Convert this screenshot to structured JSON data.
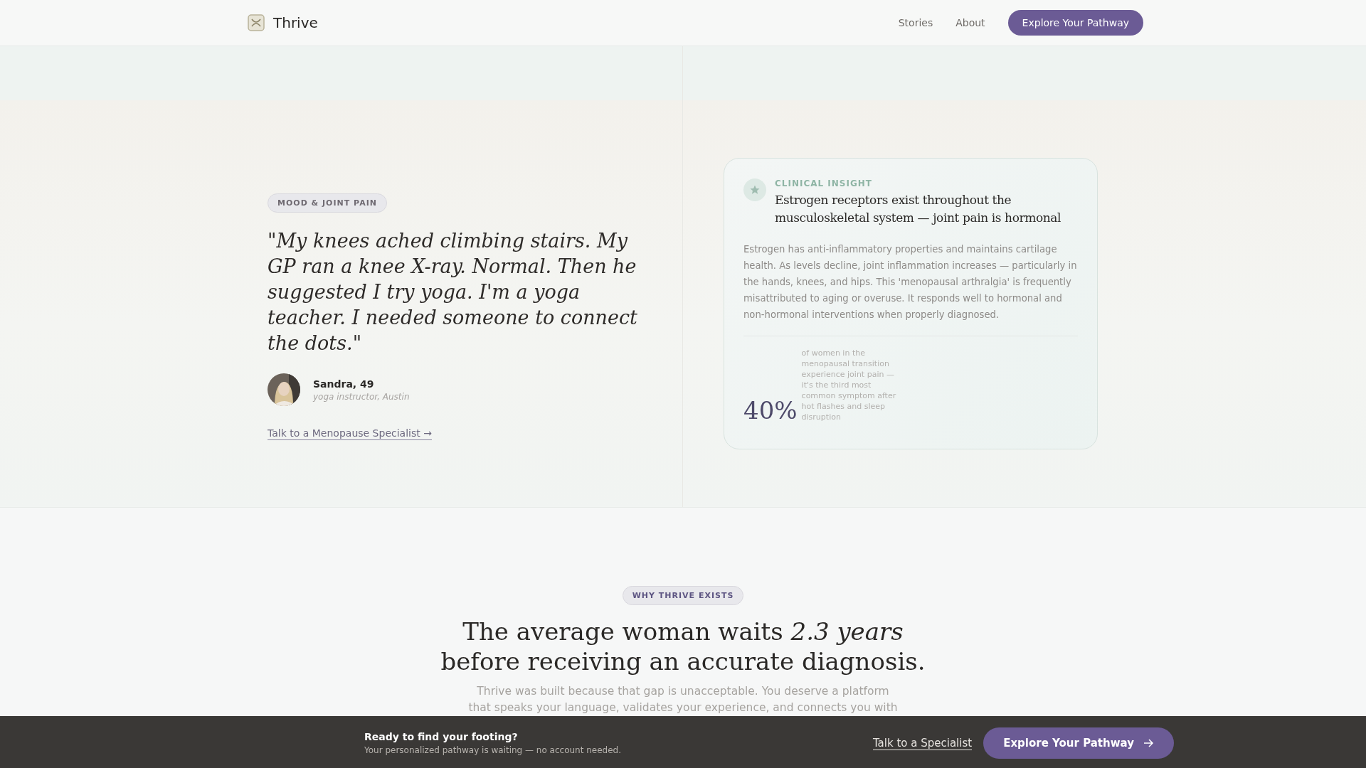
{
  "header": {
    "brand": "Thrive",
    "nav": [
      {
        "label": "Stories"
      },
      {
        "label": "About"
      }
    ],
    "cta": "Explore Your Pathway"
  },
  "story": {
    "tag": "MOOD & JOINT PAIN",
    "quote": "\"My knees ached climbing stairs. My GP ran a knee X-ray. Normal. Then he suggested I try yoga. I'm a yoga teacher. I needed someone to connect the dots.\"",
    "author": {
      "name": "Sandra, 49",
      "role": "yoga instructor, Austin"
    },
    "link": "Talk to a Menopause Specialist →"
  },
  "insight": {
    "eyebrow": "CLINICAL INSIGHT",
    "title": "Estrogen receptors exist throughout the musculoskeletal system — joint pain is hormonal",
    "body": "Estrogen has anti-inflammatory properties and maintains cartilage health. As levels decline, joint inflammation increases — particularly in the hands, knees, and hips. This 'menopausal arthralgia' is frequently misattributed to aging or overuse. It responds well to hormonal and non-hormonal interventions when properly diagnosed.",
    "stat": "40%",
    "stat_caption": "of women in the menopausal transition experience joint pain — it's the third most common symptom after hot flashes and sleep disruption"
  },
  "why": {
    "tag": "WHY THRIVE EXISTS",
    "heading_1": "The average woman waits *2.3 years*",
    "heading_2": "before receiving an accurate diagnosis.",
    "paragraph": [
      "Thrive was built because that gap is unacceptable. You deserve a platform",
      "that speaks your language, validates your experience, and connects you with"
    ]
  },
  "bottom_bar": {
    "title": "Ready to find your footing?",
    "subtitle": "Your personalized pathway is waiting — no account needed.",
    "link": "Talk to a Specialist",
    "cta": "Explore Your Pathway"
  }
}
